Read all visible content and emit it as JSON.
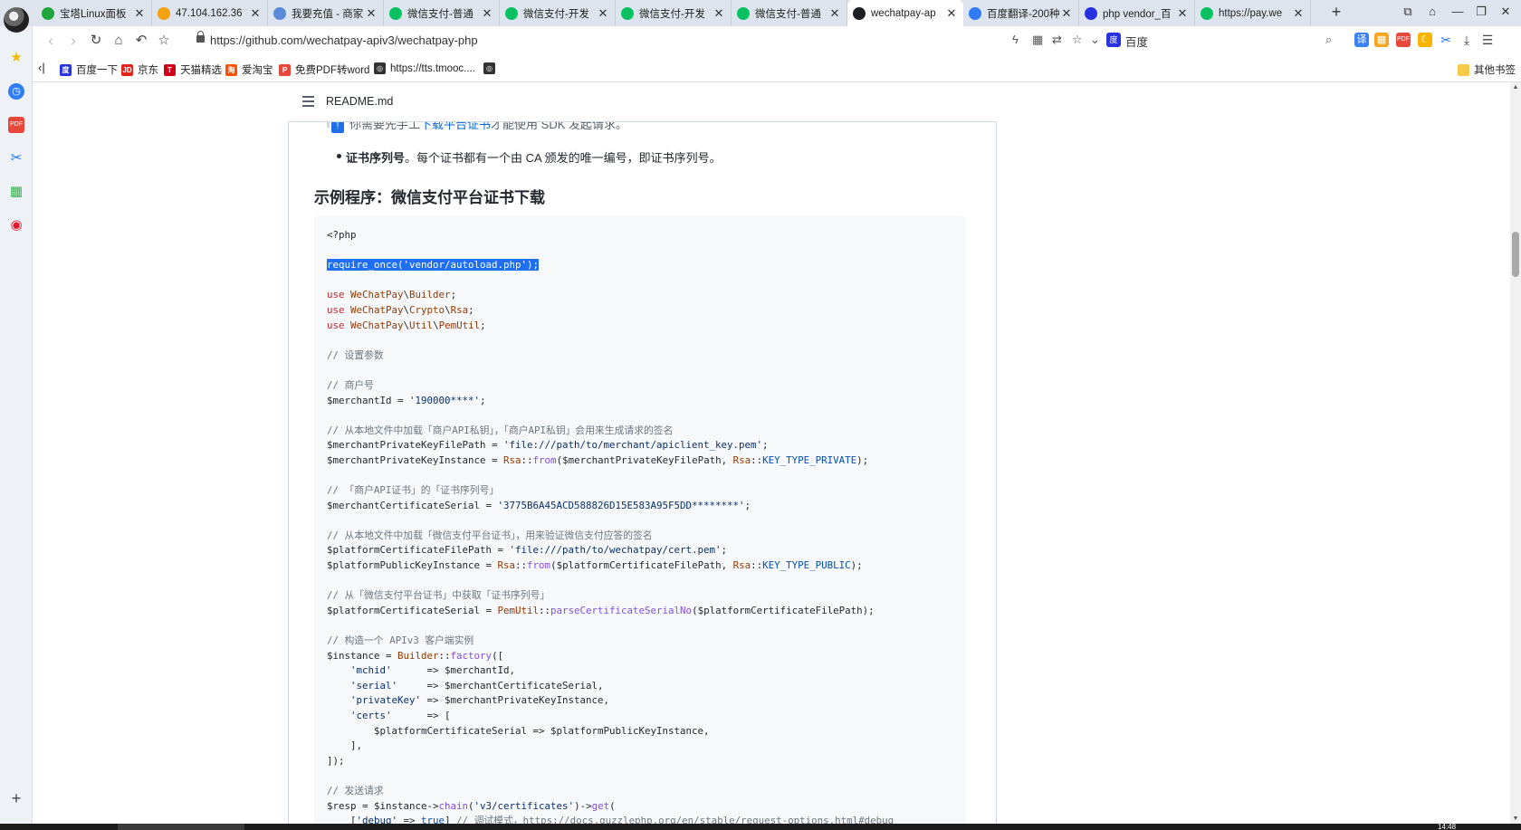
{
  "browser": {
    "tabs": [
      {
        "title": "宝塔Linux面板",
        "fav_color": "#20a53a",
        "fav_glyph": "shield-icon"
      },
      {
        "title": "47.104.162.36",
        "fav_color": "#f3a10e",
        "fav_glyph": "server-icon"
      },
      {
        "title": "我要充值 - 商家",
        "fav_color": "#5a8bd8",
        "fav_glyph": "site-icon"
      },
      {
        "title": "微信支付-普通",
        "fav_color": "#07c160",
        "fav_glyph": "wechatpay-icon"
      },
      {
        "title": "微信支付-开发",
        "fav_color": "#07c160",
        "fav_glyph": "wechatpay-icon"
      },
      {
        "title": "微信支付-开发",
        "fav_color": "#07c160",
        "fav_glyph": "wechatpay-icon"
      },
      {
        "title": "微信支付-普通",
        "fav_color": "#07c160",
        "fav_glyph": "wechatpay-icon"
      },
      {
        "title": "wechatpay-ap",
        "fav_color": "#1b1f23",
        "fav_glyph": "github-icon",
        "active": true
      },
      {
        "title": "百度翻译-200种",
        "fav_color": "#2f7cf6",
        "fav_glyph": "translate-icon"
      },
      {
        "title": "php vendor_百",
        "fav_color": "#2932e1",
        "fav_glyph": "baidu-paw-icon"
      },
      {
        "title": "https://pay.we",
        "fav_color": "#07c160",
        "fav_glyph": "wechatpay-icon"
      }
    ],
    "url": "https://github.com/wechatpay-apiv3/wechatpay-php",
    "search_engine": "百度",
    "bookmarks": [
      {
        "label": "百度一下",
        "color": "#2932e1",
        "glyph": "度"
      },
      {
        "label": "京东",
        "color": "#e1251b",
        "glyph": "JD"
      },
      {
        "label": "天猫精选",
        "color": "#d0021b",
        "glyph": "T"
      },
      {
        "label": "爱淘宝",
        "color": "#ff5000",
        "glyph": "淘"
      },
      {
        "label": "免费PDF转word",
        "color": "#e8473b",
        "glyph": "P"
      },
      {
        "label": "https://tts.tmooc....",
        "color": "#333333",
        "glyph": "◎"
      },
      {
        "label": "",
        "color": "#333333",
        "glyph": "◎"
      }
    ],
    "other_bookmarks": "其他书签"
  },
  "readme": {
    "filename": "README.md",
    "cut_line_prefix": "你需要先手工",
    "cut_line_link": "下载平台证书",
    "cut_line_suffix": "才能使用 SDK 发起请求。",
    "bullet_bold": "证书序列号",
    "bullet_rest": "。每个证书都有一个由 CA 颁发的唯一编号，即证书序列号。",
    "heading": "示例程序：微信支付平台证书下载"
  },
  "code_lines": [
    [
      {
        "t": "<?php",
        "c": ""
      }
    ],
    [],
    [
      {
        "t": "require_once('vendor/autoload.php');",
        "c": "sel"
      }
    ],
    [],
    [
      {
        "t": "use ",
        "c": "kw"
      },
      {
        "t": "WeChatPay",
        "c": "cls"
      },
      {
        "t": "\\",
        "c": ""
      },
      {
        "t": "Builder",
        "c": "cls"
      },
      {
        "t": ";",
        "c": ""
      }
    ],
    [
      {
        "t": "use ",
        "c": "kw"
      },
      {
        "t": "WeChatPay",
        "c": "cls"
      },
      {
        "t": "\\",
        "c": ""
      },
      {
        "t": "Crypto",
        "c": "cls"
      },
      {
        "t": "\\",
        "c": ""
      },
      {
        "t": "Rsa",
        "c": "cls"
      },
      {
        "t": ";",
        "c": ""
      }
    ],
    [
      {
        "t": "use ",
        "c": "kw"
      },
      {
        "t": "WeChatPay",
        "c": "cls"
      },
      {
        "t": "\\",
        "c": ""
      },
      {
        "t": "Util",
        "c": "cls"
      },
      {
        "t": "\\",
        "c": ""
      },
      {
        "t": "PemUtil",
        "c": "cls"
      },
      {
        "t": ";",
        "c": ""
      }
    ],
    [],
    [
      {
        "t": "// 设置参数",
        "c": "cmt"
      }
    ],
    [],
    [
      {
        "t": "// 商户号",
        "c": "cmt"
      }
    ],
    [
      {
        "t": "$merchantId = ",
        "c": ""
      },
      {
        "t": "'190000****'",
        "c": "str"
      },
      {
        "t": ";",
        "c": ""
      }
    ],
    [],
    [
      {
        "t": "// 从本地文件中加载「商户API私钥」，「商户API私钥」会用来生成请求的签名",
        "c": "cmt"
      }
    ],
    [
      {
        "t": "$merchantPrivateKeyFilePath = ",
        "c": ""
      },
      {
        "t": "'file:///path/to/merchant/apiclient_key.pem'",
        "c": "str"
      },
      {
        "t": ";",
        "c": ""
      }
    ],
    [
      {
        "t": "$merchantPrivateKeyInstance = ",
        "c": ""
      },
      {
        "t": "Rsa",
        "c": "cls"
      },
      {
        "t": "::",
        "c": ""
      },
      {
        "t": "from",
        "c": "fn"
      },
      {
        "t": "($merchantPrivateKeyFilePath, ",
        "c": ""
      },
      {
        "t": "Rsa",
        "c": "cls"
      },
      {
        "t": "::",
        "c": ""
      },
      {
        "t": "KEY_TYPE_PRIVATE",
        "c": "const"
      },
      {
        "t": ");",
        "c": ""
      }
    ],
    [],
    [
      {
        "t": "// 「商户API证书」的「证书序列号」",
        "c": "cmt"
      }
    ],
    [
      {
        "t": "$merchantCertificateSerial = ",
        "c": ""
      },
      {
        "t": "'3775B6A45ACD588826D15E583A95F5DD********'",
        "c": "str"
      },
      {
        "t": ";",
        "c": ""
      }
    ],
    [],
    [
      {
        "t": "// 从本地文件中加载「微信支付平台证书」，用来验证微信支付应答的签名",
        "c": "cmt"
      }
    ],
    [
      {
        "t": "$platformCertificateFilePath = ",
        "c": ""
      },
      {
        "t": "'file:///path/to/wechatpay/cert.pem'",
        "c": "str"
      },
      {
        "t": ";",
        "c": ""
      }
    ],
    [
      {
        "t": "$platformPublicKeyInstance = ",
        "c": ""
      },
      {
        "t": "Rsa",
        "c": "cls"
      },
      {
        "t": "::",
        "c": ""
      },
      {
        "t": "from",
        "c": "fn"
      },
      {
        "t": "($platformCertificateFilePath, ",
        "c": ""
      },
      {
        "t": "Rsa",
        "c": "cls"
      },
      {
        "t": "::",
        "c": ""
      },
      {
        "t": "KEY_TYPE_PUBLIC",
        "c": "const"
      },
      {
        "t": ");",
        "c": ""
      }
    ],
    [],
    [
      {
        "t": "// 从「微信支付平台证书」中获取「证书序列号」",
        "c": "cmt"
      }
    ],
    [
      {
        "t": "$platformCertificateSerial = ",
        "c": ""
      },
      {
        "t": "PemUtil",
        "c": "cls"
      },
      {
        "t": "::",
        "c": ""
      },
      {
        "t": "parseCertificateSerialNo",
        "c": "fn"
      },
      {
        "t": "($platformCertificateFilePath);",
        "c": ""
      }
    ],
    [],
    [
      {
        "t": "// 构造一个 APIv3 客户端实例",
        "c": "cmt"
      }
    ],
    [
      {
        "t": "$instance = ",
        "c": ""
      },
      {
        "t": "Builder",
        "c": "cls"
      },
      {
        "t": "::",
        "c": ""
      },
      {
        "t": "factory",
        "c": "fn"
      },
      {
        "t": "([",
        "c": ""
      }
    ],
    [
      {
        "t": "    ",
        "c": ""
      },
      {
        "t": "'mchid'",
        "c": "str"
      },
      {
        "t": "      => $merchantId,",
        "c": ""
      }
    ],
    [
      {
        "t": "    ",
        "c": ""
      },
      {
        "t": "'serial'",
        "c": "str"
      },
      {
        "t": "     => $merchantCertificateSerial,",
        "c": ""
      }
    ],
    [
      {
        "t": "    ",
        "c": ""
      },
      {
        "t": "'privateKey'",
        "c": "str"
      },
      {
        "t": " => $merchantPrivateKeyInstance,",
        "c": ""
      }
    ],
    [
      {
        "t": "    ",
        "c": ""
      },
      {
        "t": "'certs'",
        "c": "str"
      },
      {
        "t": "      => [",
        "c": ""
      }
    ],
    [
      {
        "t": "        $platformCertificateSerial => $platformPublicKeyInstance,",
        "c": ""
      }
    ],
    [
      {
        "t": "    ],",
        "c": ""
      }
    ],
    [
      {
        "t": "]);",
        "c": ""
      }
    ],
    [],
    [
      {
        "t": "// 发送请求",
        "c": "cmt"
      }
    ],
    [
      {
        "t": "$resp = $instance->",
        "c": ""
      },
      {
        "t": "chain",
        "c": "fn"
      },
      {
        "t": "(",
        "c": ""
      },
      {
        "t": "'v3/certificates'",
        "c": "str"
      },
      {
        "t": ")->",
        "c": ""
      },
      {
        "t": "get",
        "c": "fn"
      },
      {
        "t": "(",
        "c": ""
      }
    ],
    [
      {
        "t": "    [",
        "c": ""
      },
      {
        "t": "'debug'",
        "c": "str"
      },
      {
        "t": " => ",
        "c": ""
      },
      {
        "t": "true",
        "c": "const"
      },
      {
        "t": "] ",
        "c": ""
      },
      {
        "t": "// 调试模式，https://docs.guzzlephp.org/en/stable/request-options.html#debug",
        "c": "cmt"
      }
    ]
  ],
  "clock": "14:48"
}
